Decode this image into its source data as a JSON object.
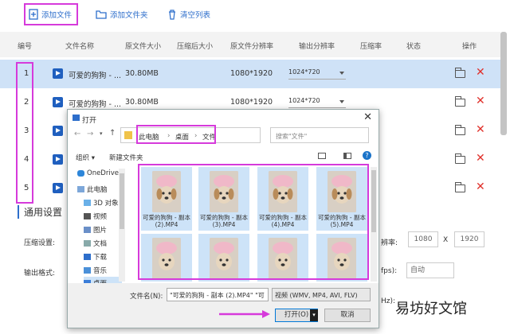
{
  "toolbar": {
    "add_file": "添加文件",
    "add_folder": "添加文件夹",
    "clear_list": "清空列表"
  },
  "table": {
    "headers": [
      "编号",
      "文件名称",
      "原文件大小",
      "压缩后大小",
      "原文件分辨率",
      "输出分辨率",
      "压缩率",
      "状态",
      "操作"
    ],
    "rows": [
      {
        "index": "1",
        "name": "可爱的狗狗 - ...",
        "size": "30.80MB",
        "resolution": "1080*1920",
        "output": "1024*720"
      },
      {
        "index": "2",
        "name": "可爱的狗狗 - ...",
        "size": "30.80MB",
        "resolution": "1080*1920",
        "output": "1024*720"
      },
      {
        "index": "3",
        "name": "",
        "size": "",
        "resolution": "",
        "output": ""
      },
      {
        "index": "4",
        "name": "",
        "size": "",
        "resolution": "",
        "output": ""
      },
      {
        "index": "5",
        "name": "",
        "size": "",
        "resolution": "",
        "output": ""
      }
    ]
  },
  "settings": {
    "title": "通用设置",
    "compress_label": "压缩设置:",
    "format_label": "输出格式:",
    "ratio_partial": "辨率:",
    "width": "1080",
    "x": "X",
    "height": "1920",
    "fps_partial": "fps):",
    "fps_value": "自动",
    "hz_partial": "Hz):"
  },
  "dialog": {
    "title": "打开",
    "path": [
      "此电脑",
      "桌面",
      "文件"
    ],
    "search_placeholder": "搜索\"文件\"",
    "organize": "组织 ▾",
    "new_folder": "新建文件夹",
    "nav": [
      "OneDrive",
      "此电脑",
      "3D 对象",
      "视频",
      "图片",
      "文档",
      "下载",
      "音乐",
      "桌面"
    ],
    "files": [
      "可爱的狗狗 - 副本 (2).MP4",
      "可爱的狗狗 - 副本 (3).MP4",
      "可爱的狗狗 - 副本 (4).MP4",
      "可爱的狗狗 - 副本 (5).MP4"
    ],
    "filename_label": "文件名(N):",
    "filename_value": "\"可爱的狗狗 - 副本 (2).MP4\" \"可",
    "filetype": "视频 (WMV, MP4, AVI, FLV)",
    "open_button": "打开(O)",
    "cancel_button": "取消"
  },
  "watermark": "易坊好文馆",
  "colors": {
    "accent": "#2d6ecb",
    "highlight": "#d63adb",
    "selected_row": "#cfe2f7",
    "delete": "#e0302a"
  }
}
